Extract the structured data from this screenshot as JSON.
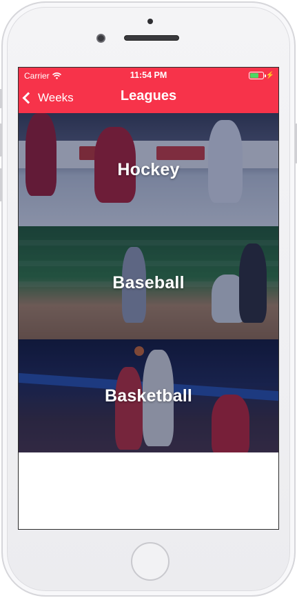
{
  "status_bar": {
    "carrier": "Carrier",
    "time": "11:54 PM"
  },
  "nav": {
    "back_label": "Weeks",
    "title": "Leagues"
  },
  "leagues": [
    {
      "name": "Hockey"
    },
    {
      "name": "Baseball"
    },
    {
      "name": "Basketball"
    }
  ],
  "colors": {
    "accent": "#f7334a",
    "battery": "#4cd964"
  },
  "icons": {
    "wifi": "wifi-icon",
    "battery": "battery-icon",
    "back": "chevron-left-icon"
  }
}
